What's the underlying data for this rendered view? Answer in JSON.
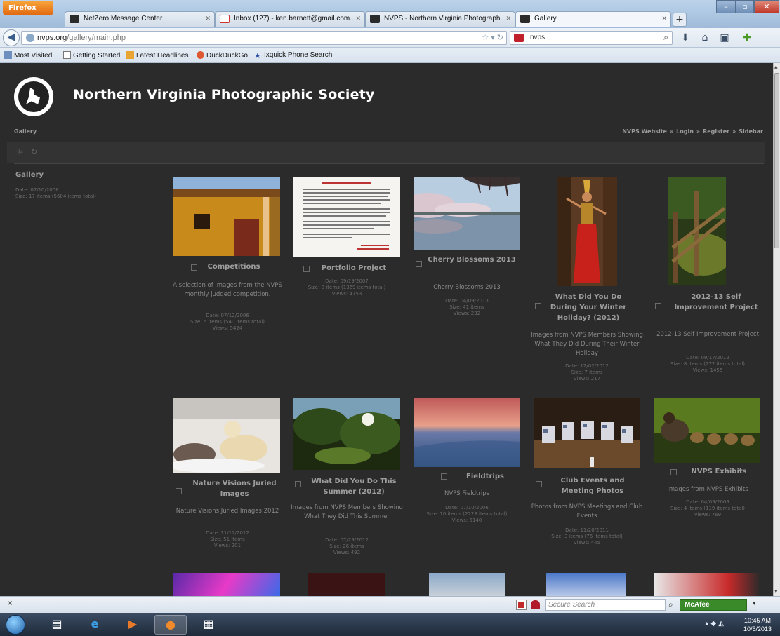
{
  "browser": {
    "menu_button": "Firefox",
    "tabs": [
      {
        "label": "NetZero Message Center"
      },
      {
        "label": "Inbox (127) - ken.barnett@gmail.com..."
      },
      {
        "label": "NVPS - Northern Virginia Photograph..."
      },
      {
        "label": "Gallery"
      }
    ],
    "new_tab": "+",
    "url_domain": "nvps.org",
    "url_path": "/gallery/main.php",
    "search_value": "nvps",
    "bookmarks": [
      "Most Visited",
      "Getting Started",
      "Latest Headlines",
      "DuckDuckGo",
      "Ixquick Phone Search"
    ]
  },
  "site": {
    "title": "Northern Virginia Photographic Society",
    "breadcrumb": "Gallery",
    "topnav": [
      "NVPS Website",
      "Login",
      "Register",
      "Sidebar"
    ],
    "topnav_sep": "»"
  },
  "sidebar": {
    "title": "Gallery",
    "date": "Date: 07/10/2006",
    "size": "Size: 17 items (5604 items total)"
  },
  "albums": [
    {
      "title": "Competitions",
      "desc": "A selection of images from the NVPS monthly judged competition.",
      "date": "Date: 07/12/2006",
      "size": "Size: 5 items (540 items total)",
      "views": "Views: 5424"
    },
    {
      "title": "Portfolio Project",
      "desc": "",
      "date": "Date: 09/19/2007",
      "size": "Size: 8 items (1369 items total)",
      "views": "Views: 4753"
    },
    {
      "title": "Cherry Blossoms 2013",
      "desc": "Cherry Blossoms 2013",
      "date": "Date: 04/09/2013",
      "size": "Size: 41 items",
      "views": "Views: 232"
    },
    {
      "title": "What Did You Do During Your Winter Holiday? (2012)",
      "desc": "Images from NVPS Members Showing What They Did During Their Winter Holiday",
      "date": "Date: 12/02/2012",
      "size": "Size: 7 items",
      "views": "Views: 217"
    },
    {
      "title": "2012-13 Self Improvement Project",
      "desc": "2012-13 Self Improvement Project",
      "date": "Date: 09/17/2012",
      "size": "Size: 8 items (272 items total)",
      "views": "Views: 1455"
    },
    {
      "title": "Nature Visions Juried Images",
      "desc": "Nature Visions Juried Images 2012",
      "date": "Date: 11/12/2012",
      "size": "Size: 51 items",
      "views": "Views: 201"
    },
    {
      "title": "What Did You Do This Summer (2012)",
      "desc": "Images from NVPS Members Showing What They Did This Summer",
      "date": "Date: 07/29/2012",
      "size": "Size: 26 items",
      "views": "Views: 492"
    },
    {
      "title": "Fieldtrips",
      "desc": "NVPS Fieldtrips",
      "date": "Date: 07/10/2006",
      "size": "Size: 10 items (2228 items total)",
      "views": "Views: 5140"
    },
    {
      "title": "Club Events and Meeting Photos",
      "desc": "Photos from NVPS Meetings and Club Events",
      "date": "Date: 11/20/2011",
      "size": "Size: 3 items (76 items total)",
      "views": "Views: 445"
    },
    {
      "title": "NVPS Exhibits",
      "desc": "Images from NVPS Exhibits",
      "date": "Date: 04/09/2009",
      "size": "Size: 4 items (119 items total)",
      "views": "Views: 769"
    }
  ],
  "statusbar": {
    "close": "×",
    "search_placeholder": "Secure Search",
    "mcafee": "McAfee"
  },
  "taskbar": {
    "time": "10:45 AM",
    "date": "10/5/2013"
  },
  "colors": {
    "page_bg": "#2b2b2b",
    "title_text": "#ffffff",
    "muted_text": "#9d9d9d"
  }
}
